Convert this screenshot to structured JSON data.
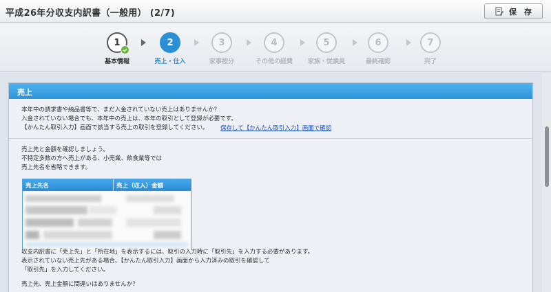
{
  "header": {
    "title": "平成26年分収支内訳書（一般用） (2/7)",
    "save_label": "保　存"
  },
  "stepper": {
    "steps": [
      {
        "number": "1",
        "label": "基本情報",
        "state": "done"
      },
      {
        "number": "2",
        "label": "売上・仕入",
        "state": "active"
      },
      {
        "number": "3",
        "label": "家事按分",
        "state": "todo"
      },
      {
        "number": "4",
        "label": "その他の経費",
        "state": "todo"
      },
      {
        "number": "5",
        "label": "家族・従業員",
        "state": "todo"
      },
      {
        "number": "6",
        "label": "最終確認",
        "state": "todo"
      },
      {
        "number": "7",
        "label": "完了",
        "state": "todo"
      }
    ]
  },
  "panel": {
    "title": "売上",
    "intro_lines": [
      "本年中の請求書や納品書等で、まだ入金されていない売上はありませんか？",
      "入金されていない場合でも、本年中の売上は、本年の取引として登録が必要です。",
      "【かんたん取引入力】画面で該当する売上の取引を登録してください。"
    ],
    "link_text": "保存して【かんたん取引入力】画面で確認",
    "confirm_lines": [
      "売上先と金額を確認しましょう。",
      "不特定多数の方へ売上がある、小売業、飲食業等では",
      "売上先名を省略できます。"
    ],
    "table": {
      "columns": [
        "売上先名",
        "売上（収入）金額"
      ]
    },
    "note_lines": [
      "収支内訳書に「売上先」と「所在地」を表示するには、取引の入力時に「取引先」を入力する必要があります。",
      "表示されていない売上先がある場合、【かんたん取引入力】画面から入力済みの取引を確認して",
      "「取引先」を入力してください。"
    ],
    "question": "売上先、売上金額に間違いはありませんか？"
  },
  "colors": {
    "accent": "#2a8fd4",
    "check": "#6cb33e",
    "link": "#1a4fc4"
  }
}
